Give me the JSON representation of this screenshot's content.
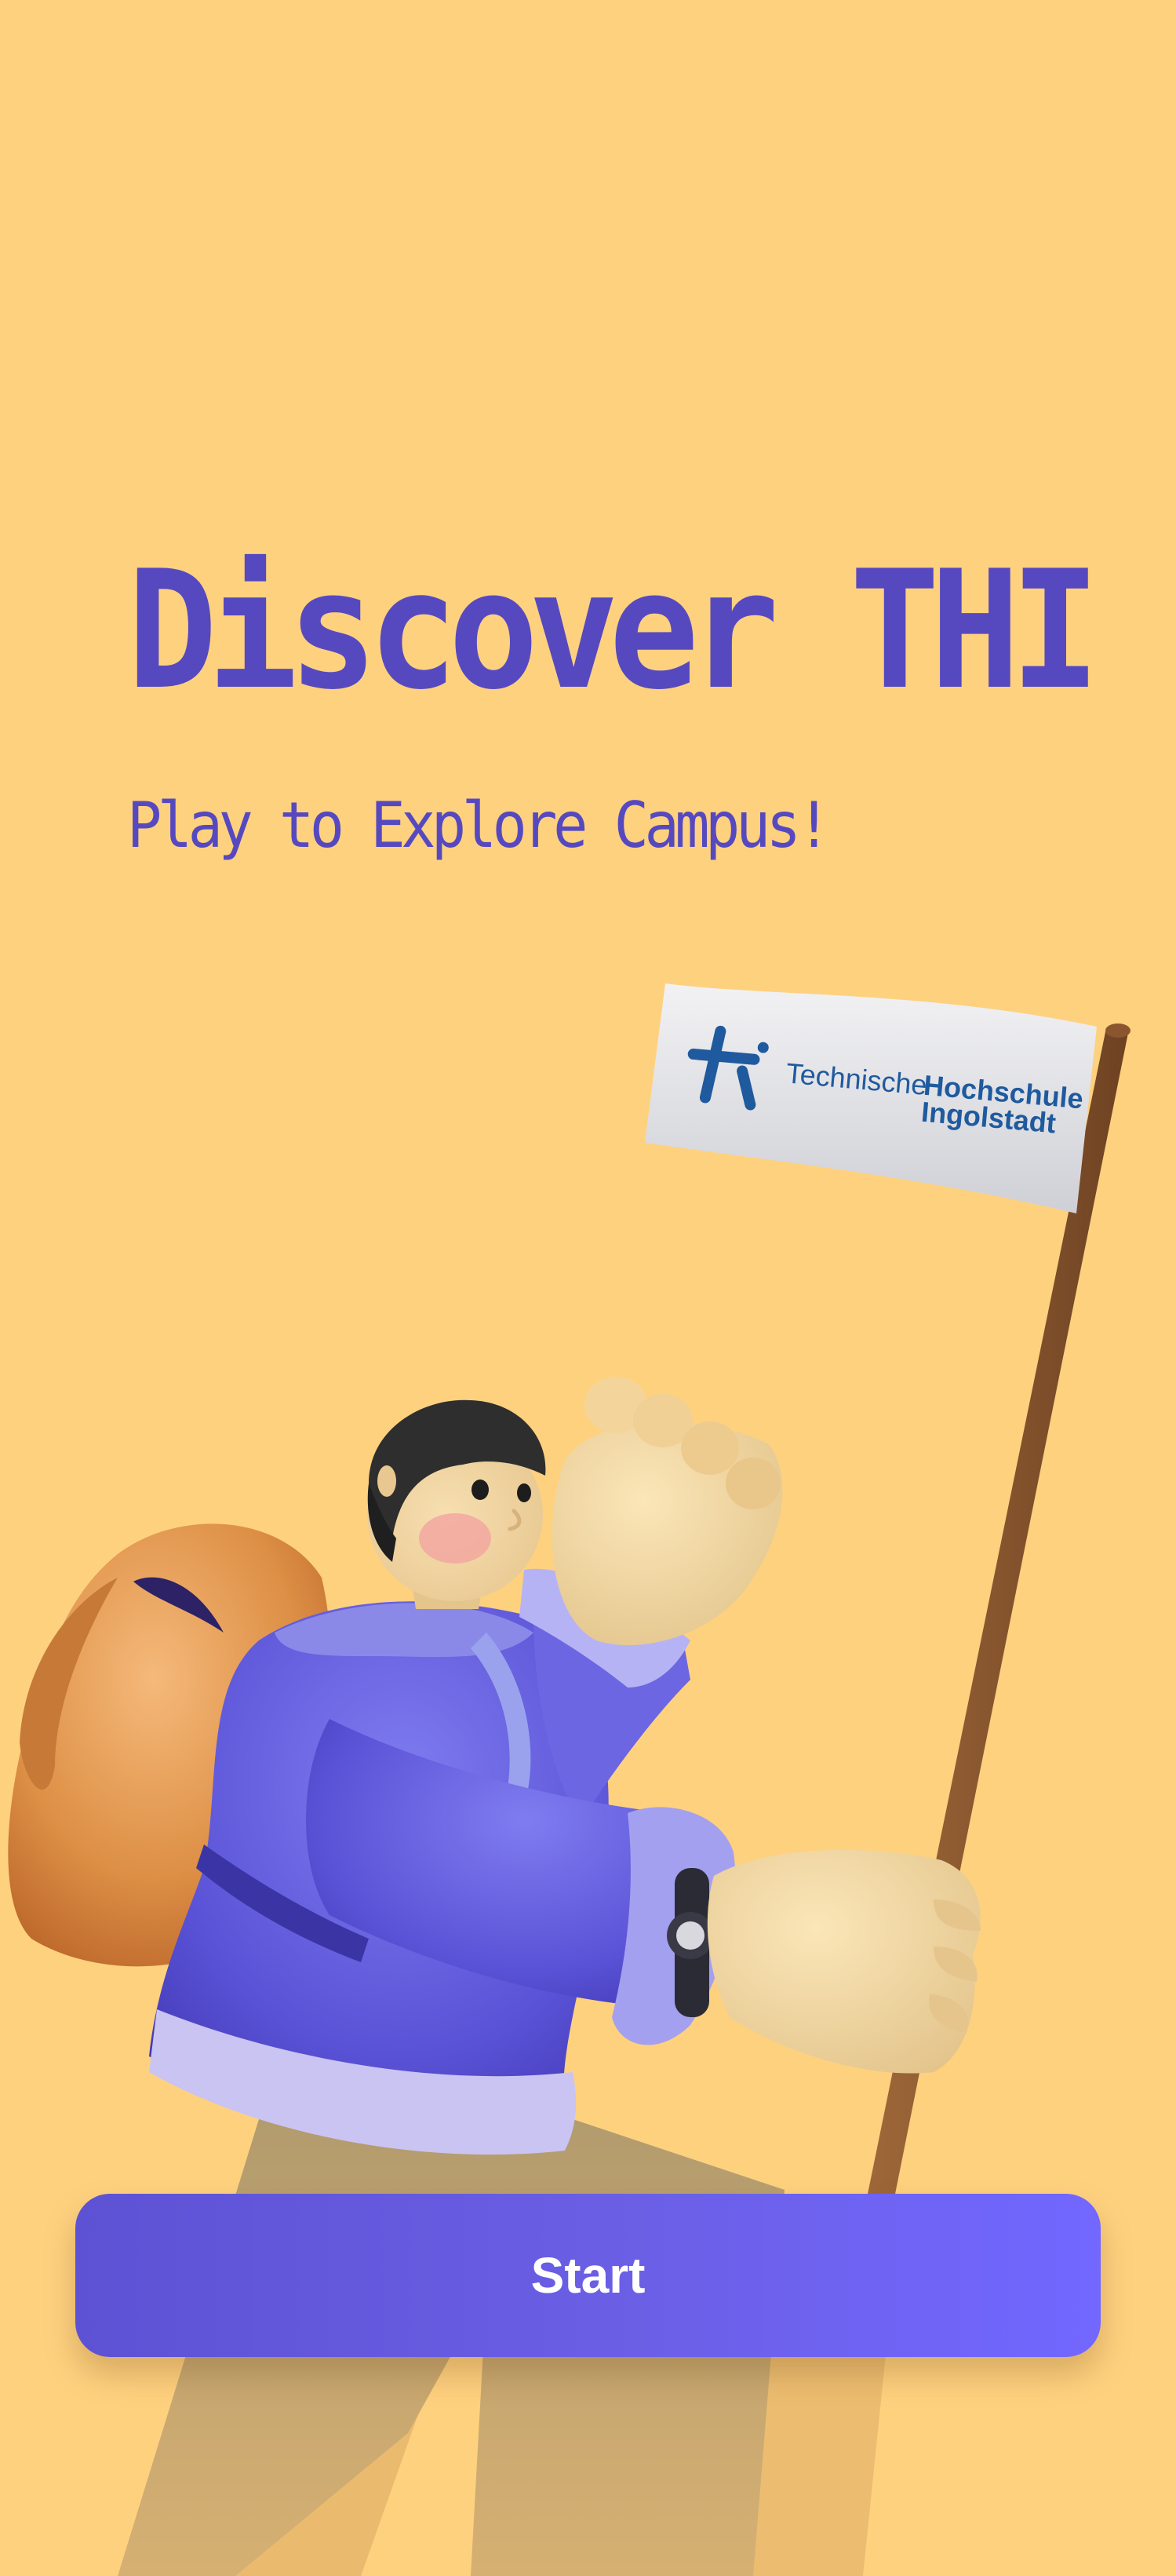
{
  "screen": {
    "title": "Discover THI",
    "subtitle": "Play to Explore Campus!"
  },
  "illustration": {
    "icon": "hiker-with-flag-illustration",
    "flag_logo": {
      "word1": "Technische",
      "word2": "Hochschule",
      "word3": "Ingolstadt"
    }
  },
  "actions": {
    "start_label": "Start"
  },
  "colors": {
    "background": "#fed17f",
    "accent": "#5649c0",
    "button_start": "#5d51d4",
    "button_end": "#7267ff",
    "logo_blue": "#1f5a9e"
  }
}
